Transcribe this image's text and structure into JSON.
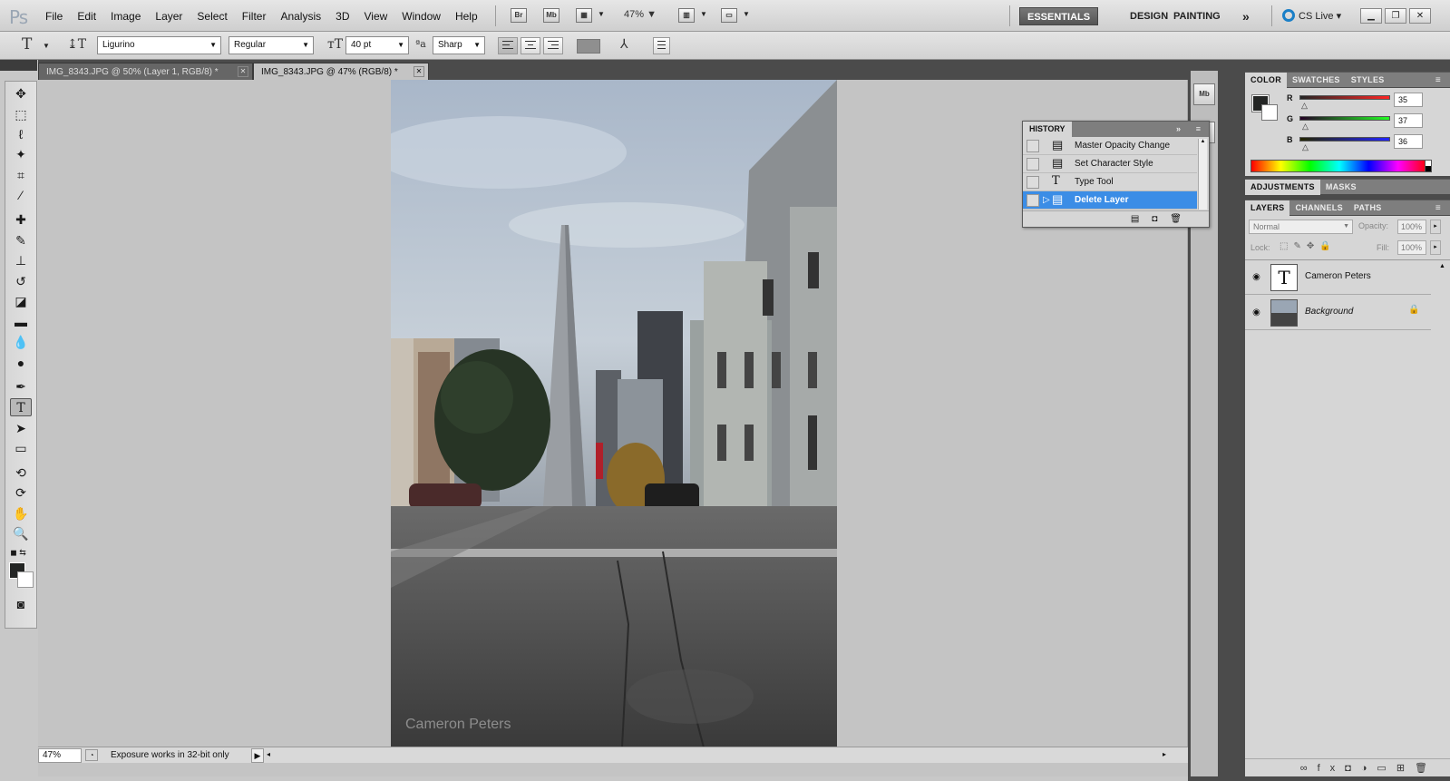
{
  "menubar": {
    "menus": [
      "File",
      "Edit",
      "Image",
      "Layer",
      "Select",
      "Filter",
      "Analysis",
      "3D",
      "View",
      "Window",
      "Help"
    ],
    "bridge_label": "Br",
    "minibridge_label": "Mb",
    "zoom": "47%",
    "workspaces": {
      "essentials": "ESSENTIALS",
      "design": "DESIGN",
      "painting": "PAINTING",
      "more": "»"
    },
    "cs_live": "CS Live"
  },
  "options": {
    "font_family": "Ligurino",
    "font_style": "Regular",
    "font_size": "40 pt",
    "anti_alias": "Sharp",
    "text_color": "#8f8f8f"
  },
  "tabs": [
    {
      "label": "IMG_8343.JPG @ 50% (Layer 1, RGB/8) *"
    },
    {
      "label": "IMG_8343.JPG @ 47% (RGB/8) *"
    }
  ],
  "canvas": {
    "watermark": "Cameron Peters"
  },
  "status": {
    "zoom": "47%",
    "text": "Exposure works in 32-bit only"
  },
  "history": {
    "title": "HISTORY",
    "items": [
      {
        "label": "Master Opacity Change"
      },
      {
        "label": "Set Character Style"
      },
      {
        "label": "Type Tool"
      },
      {
        "label": "Delete Layer"
      }
    ]
  },
  "color_panel": {
    "tabs": [
      "COLOR",
      "SWATCHES",
      "STYLES"
    ],
    "r_label": "R",
    "g_label": "G",
    "b_label": "B",
    "r": "35",
    "g": "37",
    "b": "36",
    "foreground": "#232524"
  },
  "adjust_panel": {
    "tabs": [
      "ADJUSTMENTS",
      "MASKS"
    ]
  },
  "layers_panel": {
    "tabs": [
      "LAYERS",
      "CHANNELS",
      "PATHS"
    ],
    "blend_mode": "Normal",
    "opacity_label": "Opacity:",
    "opacity": "100%",
    "lock_label": "Lock:",
    "fill_label": "Fill:",
    "fill": "100%",
    "layers": [
      {
        "name": "Cameron Peters"
      },
      {
        "name": "Background"
      }
    ]
  }
}
